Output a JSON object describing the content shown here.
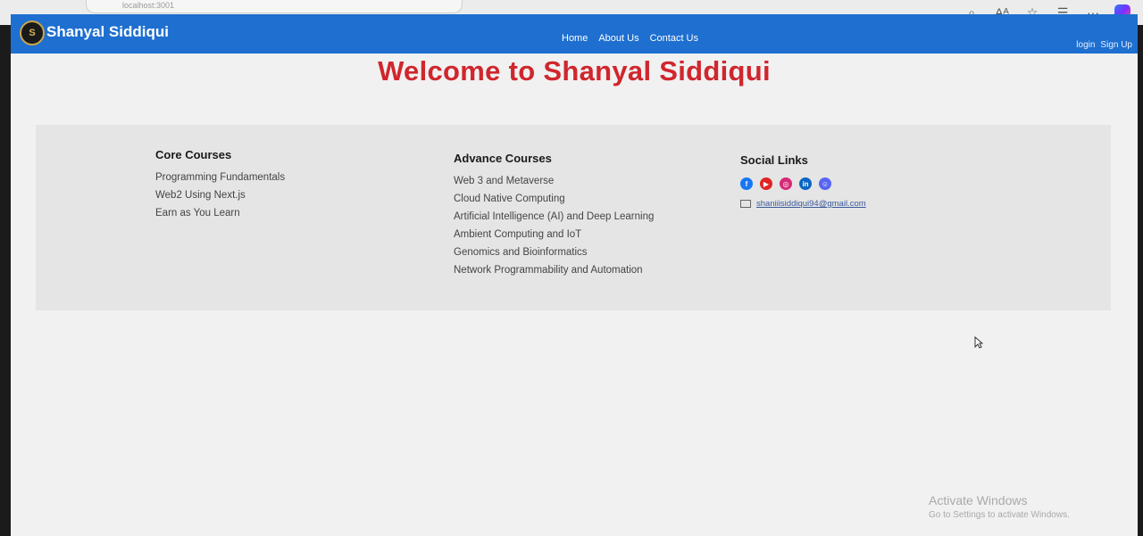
{
  "browser": {
    "address": "localhost:3001",
    "icons": [
      "zoom-icon",
      "read-aloud-icon",
      "favorite-icon",
      "favorites-list-icon",
      "more-icon",
      "copilot-icon"
    ]
  },
  "navbar": {
    "brand": "Shanyal Siddiqui",
    "logo_text": "S",
    "links": [
      "Home",
      "About Us",
      "Contact Us"
    ],
    "auth": [
      "login",
      "Sign Up"
    ],
    "color": "#1e6fd0"
  },
  "welcome": "Welcome to Shanyal Siddiqui",
  "footer": {
    "core": {
      "title": "Core Courses",
      "items": [
        "Programming Fundamentals",
        "Web2 Using Next.js",
        "Earn as You Learn"
      ]
    },
    "advance": {
      "title": "Advance Courses",
      "items": [
        "Web 3 and Metaverse",
        "Cloud Native Computing",
        "Artificial Intelligence (AI) and Deep Learning",
        "Ambient Computing and IoT",
        "Genomics and Bioinformatics",
        "Network Programmability and Automation"
      ]
    },
    "social": {
      "title": "Social Links",
      "icons": [
        {
          "name": "facebook-icon",
          "color": "#1877f2"
        },
        {
          "name": "youtube-icon",
          "color": "#e02424"
        },
        {
          "name": "instagram-icon",
          "color": "#d62976"
        },
        {
          "name": "linkedin-icon",
          "color": "#0a66c2"
        },
        {
          "name": "discord-icon",
          "color": "#5865f2"
        }
      ],
      "email": "shaniiisiddiqui94@gmail.com"
    }
  },
  "watermark": {
    "line1": "Activate Windows",
    "line2": "Go to Settings to activate Windows."
  }
}
